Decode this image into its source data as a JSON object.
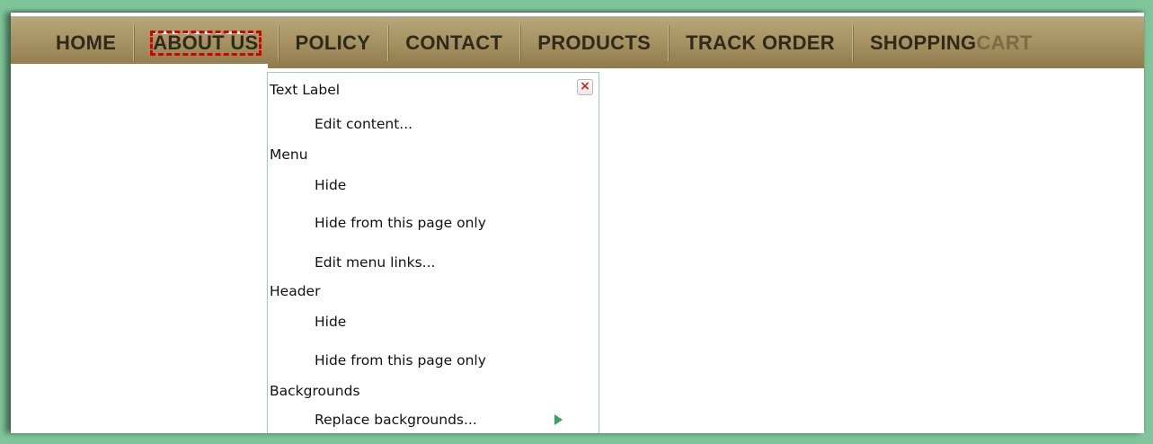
{
  "nav": {
    "items": [
      {
        "label": "HOME"
      },
      {
        "label": "ABOUT US"
      },
      {
        "label": "POLICY"
      },
      {
        "label": "CONTACT"
      },
      {
        "label": "PRODUCTS"
      },
      {
        "label": "TRACK ORDER"
      }
    ],
    "shopping": "SHOPPING",
    "cart": "CART"
  },
  "menu": {
    "text_label": {
      "heading": "Text Label",
      "edit": "Edit content..."
    },
    "menu_section": {
      "heading": "Menu",
      "hide": "Hide",
      "hide_page": "Hide from this page only",
      "edit_links": "Edit menu links..."
    },
    "header": {
      "heading": "Header",
      "hide": "Hide",
      "hide_page": "Hide from this page only"
    },
    "backgrounds": {
      "heading": "Backgrounds",
      "replace": "Replace backgrounds..."
    },
    "close_symbol": "×"
  },
  "colors": {
    "frame": "#7fc599",
    "navbar": "#a48f5f",
    "highlight_dash": "#d60000",
    "arrow": "#2ea85a"
  }
}
